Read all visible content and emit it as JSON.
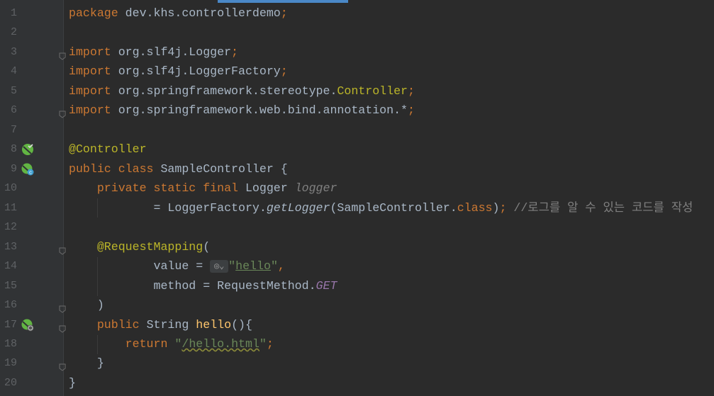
{
  "editor": {
    "lines": [
      {
        "n": "1",
        "tokens": [
          [
            "kw",
            "package "
          ],
          [
            "",
            "dev.khs.controllerdemo"
          ],
          [
            "kw",
            ";"
          ]
        ]
      },
      {
        "n": "2",
        "tokens": []
      },
      {
        "n": "3",
        "fold": true,
        "tokens": [
          [
            "kw",
            "import "
          ],
          [
            "",
            "org.slf4j.Logger"
          ],
          [
            "kw",
            ";"
          ]
        ]
      },
      {
        "n": "4",
        "tokens": [
          [
            "kw",
            "import "
          ],
          [
            "",
            "org.slf4j.LoggerFactory"
          ],
          [
            "kw",
            ";"
          ]
        ]
      },
      {
        "n": "5",
        "tokens": [
          [
            "kw",
            "import "
          ],
          [
            "",
            "org.springframework.stereotype."
          ],
          [
            "ann",
            "Controller"
          ],
          [
            "kw",
            ";"
          ]
        ]
      },
      {
        "n": "6",
        "fold": true,
        "tokens": [
          [
            "kw",
            "import "
          ],
          [
            "",
            "org.springframework.web.bind.annotation.*"
          ],
          [
            "kw",
            ";"
          ]
        ]
      },
      {
        "n": "7",
        "tokens": []
      },
      {
        "n": "8",
        "icon": "spring-bean-check-icon",
        "tokens": [
          [
            "ann",
            "@Controller"
          ]
        ]
      },
      {
        "n": "9",
        "icon": "spring-bean-class-icon",
        "tokens": [
          [
            "kw",
            "public class "
          ],
          [
            "",
            "SampleController {"
          ]
        ]
      },
      {
        "n": "10",
        "tokens": [
          [
            "",
            "    "
          ],
          [
            "kw",
            "private static final "
          ],
          [
            "",
            "Logger "
          ],
          [
            "fld",
            "logger"
          ]
        ]
      },
      {
        "n": "11",
        "tokens": [
          [
            "",
            "            = LoggerFactory."
          ],
          [
            "it",
            "getLogger"
          ],
          [
            "",
            "(SampleController."
          ],
          [
            "kw",
            "class"
          ],
          [
            "",
            ")"
          ],
          [
            "kw",
            "; "
          ],
          [
            "cmt",
            "//로그를 알 수 있는 코드를 작성"
          ]
        ]
      },
      {
        "n": "12",
        "tokens": []
      },
      {
        "n": "13",
        "fold": true,
        "tokens": [
          [
            "",
            "    "
          ],
          [
            "ann",
            "@RequestMapping"
          ],
          [
            "",
            "("
          ]
        ]
      },
      {
        "n": "14",
        "tokens": [
          [
            "",
            "            value = "
          ],
          [
            "globe",
            ""
          ],
          [
            "str",
            "\""
          ],
          [
            "strul",
            "hello"
          ],
          [
            "str",
            "\""
          ],
          [
            "kw",
            ","
          ]
        ]
      },
      {
        "n": "15",
        "tokens": [
          [
            "",
            "            method = RequestMethod."
          ],
          [
            "cst",
            "GET"
          ]
        ]
      },
      {
        "n": "16",
        "fold": true,
        "tokens": [
          [
            "",
            "    )"
          ]
        ]
      },
      {
        "n": "17",
        "icon": "spring-web-endpoint-icon",
        "fold": true,
        "tokens": [
          [
            "",
            "    "
          ],
          [
            "kw",
            "public "
          ],
          [
            "",
            "String "
          ],
          [
            "fn",
            "hello"
          ],
          [
            "",
            "(){"
          ]
        ]
      },
      {
        "n": "18",
        "tokens": [
          [
            "",
            "        "
          ],
          [
            "kw",
            "return "
          ],
          [
            "str",
            "\""
          ],
          [
            "strwave",
            "/hello.html"
          ],
          [
            "str",
            "\""
          ],
          [
            "kw",
            ";"
          ]
        ]
      },
      {
        "n": "19",
        "fold": true,
        "tokens": [
          [
            "",
            "    }"
          ]
        ]
      },
      {
        "n": "20",
        "tokens": [
          [
            "",
            "}"
          ]
        ]
      }
    ]
  }
}
